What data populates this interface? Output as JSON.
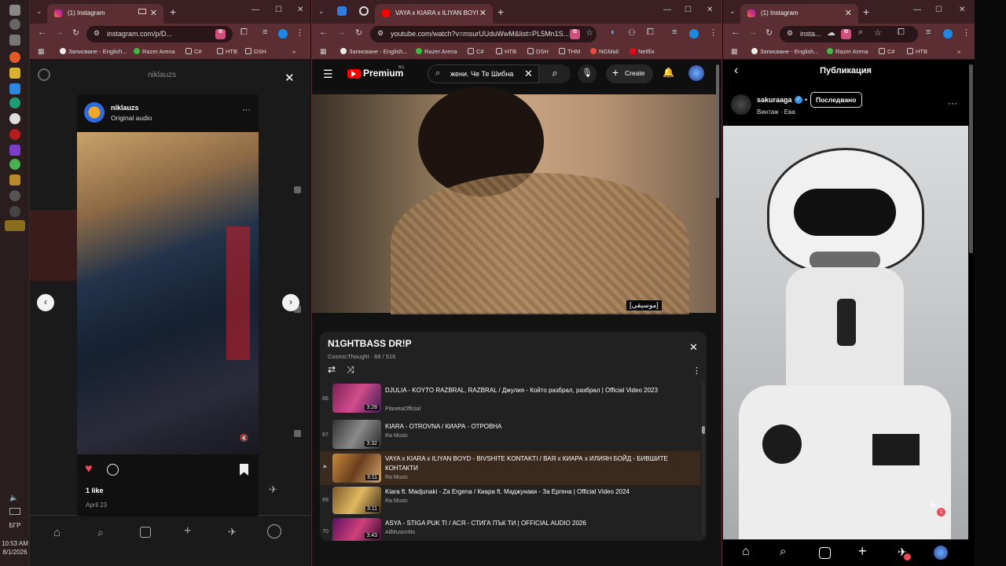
{
  "taskbar": {
    "lang": "БГР",
    "time": "10:53 AM",
    "date": "8/1/2026"
  },
  "left_window": {
    "tab_title": "(1) Instagram",
    "url": "instagram.com/p/D...",
    "bookmarks": [
      "Записване - English...",
      "Razer Arena",
      "C#",
      "НТВ",
      "DSH"
    ],
    "header_user": "niklauzs",
    "post": {
      "username": "niklauzs",
      "audio": "Original audio",
      "likes": "1 like",
      "date": "April 23"
    }
  },
  "mid_window": {
    "tab_title": "VAYA x KIARA x ILIYAN BOYD",
    "url": "youtube.com/watch?v=msurUUduWwM&list=PL5Mn1S...",
    "bookmarks": [
      "Записване - English...",
      "Razer Arena",
      "C#",
      "НТВ",
      "DSH",
      "THM",
      "NGMail",
      "Netflix"
    ],
    "logo_text": "Premium",
    "logo_sup": "BG",
    "search_value": "жени. Че Те Шибна",
    "create_label": "Create",
    "caption": "[موسيقى]",
    "playlist": {
      "title": "N1GHTBASS DR!P",
      "owner_progress": "CosmicThought · 68 / 516",
      "items": [
        {
          "num": "66",
          "title": "DJULIA - KOYTO RAZBRAL, RAZBRAL / Джулия - Който разбрал, разбрал | Official Video 2023",
          "channel": "PlanetaOfficial",
          "duration": "3:28"
        },
        {
          "num": "67",
          "title": "KIARA - OTROVNA / КИАРА - ОТРОВНА",
          "channel": "Ra Music",
          "duration": "3:32"
        },
        {
          "num": "▶",
          "title": "VAYA x KIARA x ILIYAN BOYD - BIVSHITE KONTAKTI / ВАЯ x КИАРА x ИЛИЯН БОЙД - БИВШИТЕ КОНТАКТИ",
          "channel": "Ra Music",
          "duration": "3:11"
        },
        {
          "num": "69",
          "title": "Kiara ft. Madjunaki - Za Ergena / Киара ft. Маджунаки - За Ергена | Official Video 2024",
          "channel": "Ra Music",
          "duration": "3:11"
        },
        {
          "num": "70",
          "title": "ASYA - STIGA PUK TI / АСЯ - СТИГА ПЪК ТИ | OFFICIAL AUDIO 2026",
          "channel": "AllMusicHits",
          "duration": "3:43"
        }
      ]
    }
  },
  "right_window": {
    "tab_title": "(1) Instagram",
    "url": "insta...",
    "bookmarks": [
      "Записване - English...",
      "Razer Arena",
      "C#",
      "НТВ"
    ],
    "header_title": "Публикация",
    "username": "sakuraaga",
    "follow_label": "Последвано",
    "subtitle": "Винтаж · Ева",
    "notif_count": "1"
  },
  "colors": {
    "ig_like": "#ed4956",
    "yt_red": "#ff0000",
    "chrome_frame": "#3b1f22"
  }
}
